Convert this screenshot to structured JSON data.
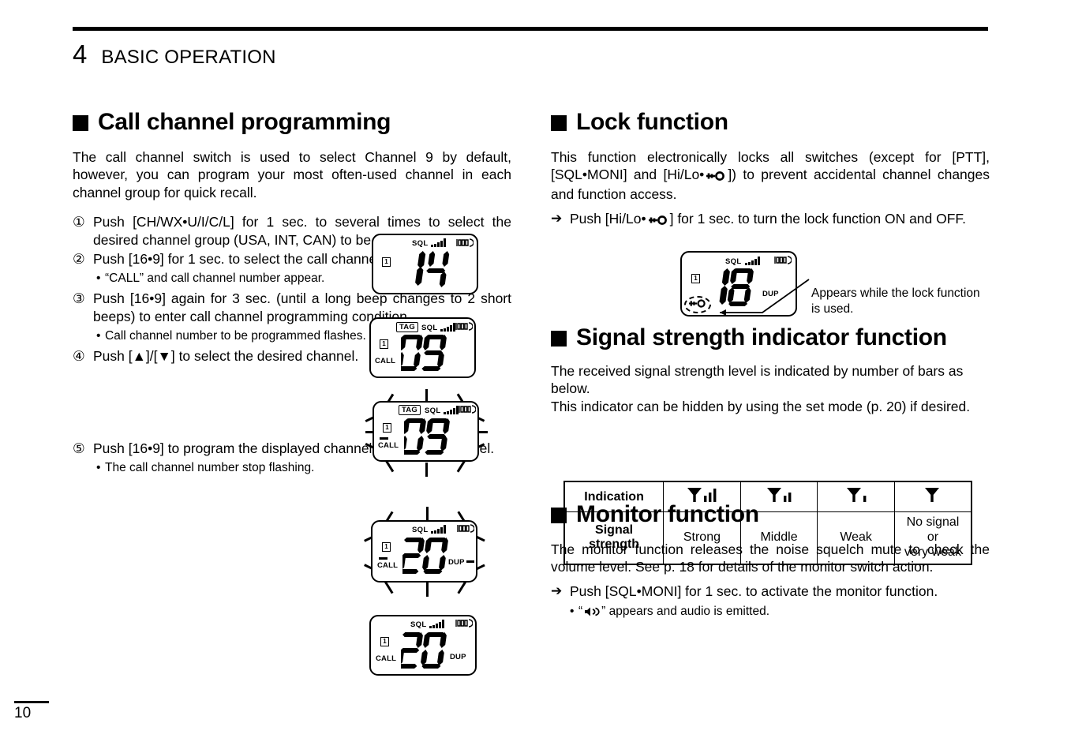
{
  "header": {
    "chapter_number": "4",
    "chapter_title": "BASIC OPERATION"
  },
  "page_number": "10",
  "left_column": {
    "section_title": "Call channel programming",
    "intro": "The call channel switch is used to select Channel 9 by default, however, you can program your most often-used channel in each channel group for quick recall.",
    "steps": [
      {
        "marker": "①",
        "text": "Push [CH/WX•U/I/C/L] for 1 sec. to several times to select the desired channel group (USA, INT, CAN) to be programmed.",
        "bullets": []
      },
      {
        "marker": "②",
        "text": "Push [16•9] for 1 sec. to select the call channel.",
        "bullets": [
          "“CALL” and call channel number appear."
        ]
      },
      {
        "marker": "③",
        "text": "Push [16•9] again for 3 sec. (until a long beep changes to 2 short beeps) to enter call channel programming condition.",
        "bullets": [
          "Call channel number to be programmed flashes."
        ]
      },
      {
        "marker": "④",
        "text": "Push [▲]/[▼] to select the desired channel.",
        "bullets": []
      },
      {
        "marker": "⑤",
        "text": "Push [16•9] to program the displayed channel as the call channel.",
        "bullets": [
          "The call channel number stop flashing."
        ]
      }
    ]
  },
  "lcd_displays": [
    {
      "id": "lcd-step1",
      "digits": "14",
      "sql_label": "SQL",
      "signal_bars": 5,
      "group_indicator": "1",
      "tag": null,
      "call": false,
      "dup": false,
      "flashing": false
    },
    {
      "id": "lcd-step2",
      "digits": "09",
      "sql_label": "SQL",
      "signal_bars": 5,
      "group_indicator": "1",
      "tag": "TAG",
      "call": true,
      "dup": false,
      "flashing": false
    },
    {
      "id": "lcd-step3",
      "digits": "09",
      "sql_label": "SQL",
      "signal_bars": 5,
      "group_indicator": "1",
      "tag": "TAG",
      "call": true,
      "dup": false,
      "flashing": true
    },
    {
      "id": "lcd-step4",
      "digits": "20",
      "sql_label": "SQL",
      "signal_bars": 5,
      "group_indicator": "1",
      "tag": null,
      "call": true,
      "dup": true,
      "flashing": true
    },
    {
      "id": "lcd-step5",
      "digits": "20",
      "sql_label": "SQL",
      "signal_bars": 5,
      "group_indicator": "1",
      "tag": null,
      "call": true,
      "dup": true,
      "flashing": false
    },
    {
      "id": "lcd-lock",
      "digits": "18",
      "sql_label": "SQL",
      "signal_bars": 5,
      "group_indicator": "1",
      "tag": null,
      "call": false,
      "dup": true,
      "flashing": false,
      "lock_key": true
    }
  ],
  "right_column": {
    "lock": {
      "section_title": "Lock function",
      "paragraph_part1": "This function electronically locks all switches (except for [PTT], [SQL•MONI] and [Hi/Lo•",
      "paragraph_part2": "]) to prevent accidental channel changes and function access.",
      "arrow_part1": "Push [Hi/Lo•",
      "arrow_part2": "] for 1 sec. to turn the lock function ON and OFF.",
      "callout": "Appears while the lock function is used."
    },
    "signal": {
      "section_title": "Signal strength indicator function",
      "paragraph": "The received signal strength level is indicated by number of bars as below.\nThis indicator can be hidden by using the set mode (p. 20) if desired.",
      "paragraph_line1": "The received signal strength level is indicated by number of bars as below.",
      "paragraph_line2": "This indicator can be hidden by using the set mode (p. 20) if desired.",
      "table": {
        "row_labels": [
          "Indication",
          "Signal strength"
        ],
        "indications": [
          {
            "icon": "antenna-3-bars",
            "bars": 3
          },
          {
            "icon": "antenna-2-bars",
            "bars": 2
          },
          {
            "icon": "antenna-1-bar",
            "bars": 1
          },
          {
            "icon": "antenna-0-bars",
            "bars": 0
          }
        ],
        "strengths": [
          "Strong",
          "Middle",
          "Weak",
          "No signal or very weak"
        ]
      }
    },
    "monitor": {
      "section_title": "Monitor function",
      "paragraph": "The monitor function releases the noise squelch mute to check the volume level. See p. 18 for details of the monitor switch action.",
      "arrow_text": "Push [SQL•MONI] for 1 sec. to activate the monitor function.",
      "bullet_part1": "“",
      "bullet_part2": "” appears and audio is emitted."
    }
  }
}
